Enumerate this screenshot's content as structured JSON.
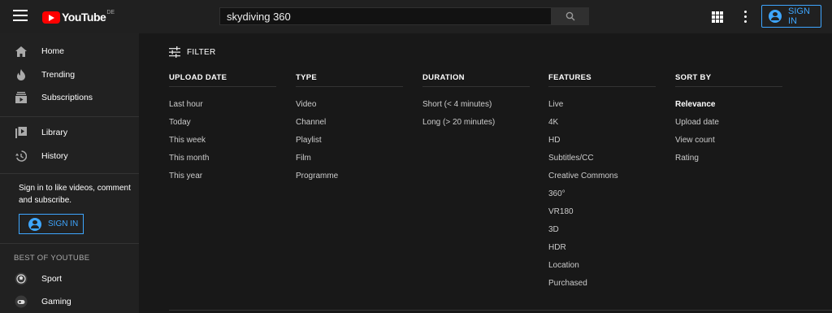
{
  "header": {
    "logo_text": "YouTube",
    "region": "DE",
    "search_value": "skydiving 360",
    "sign_in": "SIGN IN"
  },
  "sidebar": {
    "items": [
      {
        "label": "Home",
        "icon": "home-icon"
      },
      {
        "label": "Trending",
        "icon": "flame-icon"
      },
      {
        "label": "Subscriptions",
        "icon": "subscriptions-icon"
      },
      {
        "label": "Library",
        "icon": "library-icon"
      },
      {
        "label": "History",
        "icon": "history-icon"
      }
    ],
    "signin_prompt": "Sign in to like videos, comment and subscribe.",
    "signin_button": "SIGN IN",
    "best_title": "BEST OF YOUTUBE",
    "best_items": [
      {
        "label": "Sport",
        "icon": "sport-icon"
      },
      {
        "label": "Gaming",
        "icon": "gaming-icon"
      }
    ]
  },
  "filter": {
    "label": "FILTER",
    "columns": [
      {
        "title": "UPLOAD DATE",
        "items": [
          "Last hour",
          "Today",
          "This week",
          "This month",
          "This year"
        ]
      },
      {
        "title": "TYPE",
        "items": [
          "Video",
          "Channel",
          "Playlist",
          "Film",
          "Programme"
        ]
      },
      {
        "title": "DURATION",
        "items": [
          "Short (< 4 minutes)",
          "Long (> 20 minutes)"
        ]
      },
      {
        "title": "FEATURES",
        "items": [
          "Live",
          "4K",
          "HD",
          "Subtitles/CC",
          "Creative Commons",
          "360°",
          "VR180",
          "3D",
          "HDR",
          "Location",
          "Purchased"
        ]
      },
      {
        "title": "SORT BY",
        "items": [
          "Relevance",
          "Upload date",
          "View count",
          "Rating"
        ],
        "active": "Relevance"
      }
    ]
  },
  "colors": {
    "accent": "#3ea6ff",
    "brand": "#ff0000",
    "background": "#181818",
    "sidebar": "#212121"
  }
}
